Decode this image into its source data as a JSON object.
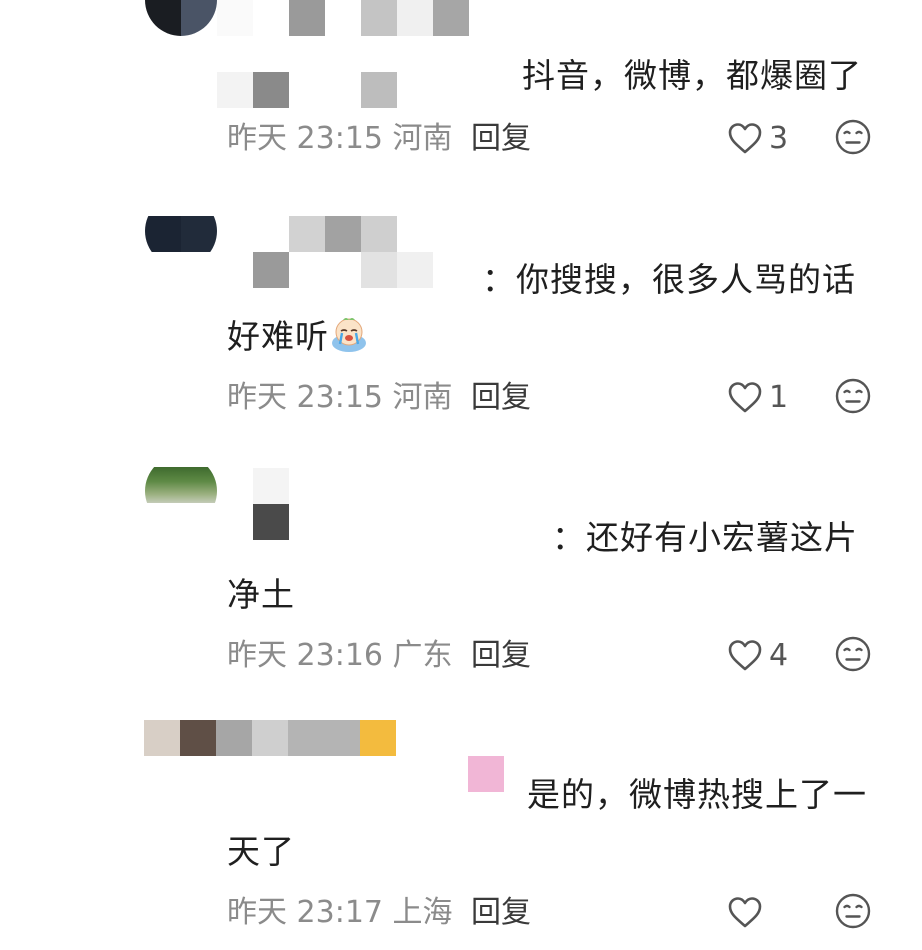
{
  "comments": [
    {
      "text": "抖音，微博，都爆圈了",
      "time": "昨天 23:15",
      "location": "河南",
      "reply_label": "回复",
      "likes": "3"
    },
    {
      "text": "：你搜搜，很多人骂的话",
      "text_line2": "好难听",
      "time": "昨天 23:15",
      "location": "河南",
      "reply_label": "回复",
      "likes": "1"
    },
    {
      "text": "：还好有小宏薯这片",
      "text_line2": "净土",
      "time": "昨天 23:16",
      "location": "广东",
      "reply_label": "回复",
      "likes": "4"
    },
    {
      "text": "是的，微博热搜上了一",
      "text_line2": "天了",
      "time": "昨天 23:17",
      "location": "上海",
      "reply_label": "回复",
      "likes": ""
    }
  ],
  "icons": {
    "like": "heart-outline-icon",
    "reaction": "neutral-face-icon",
    "emoji": "crying-face-emoji"
  },
  "colors": {
    "text": "#1f1f1f",
    "meta": "#8b8b8b",
    "reply": "#3a3a3a",
    "icon": "#555555"
  }
}
